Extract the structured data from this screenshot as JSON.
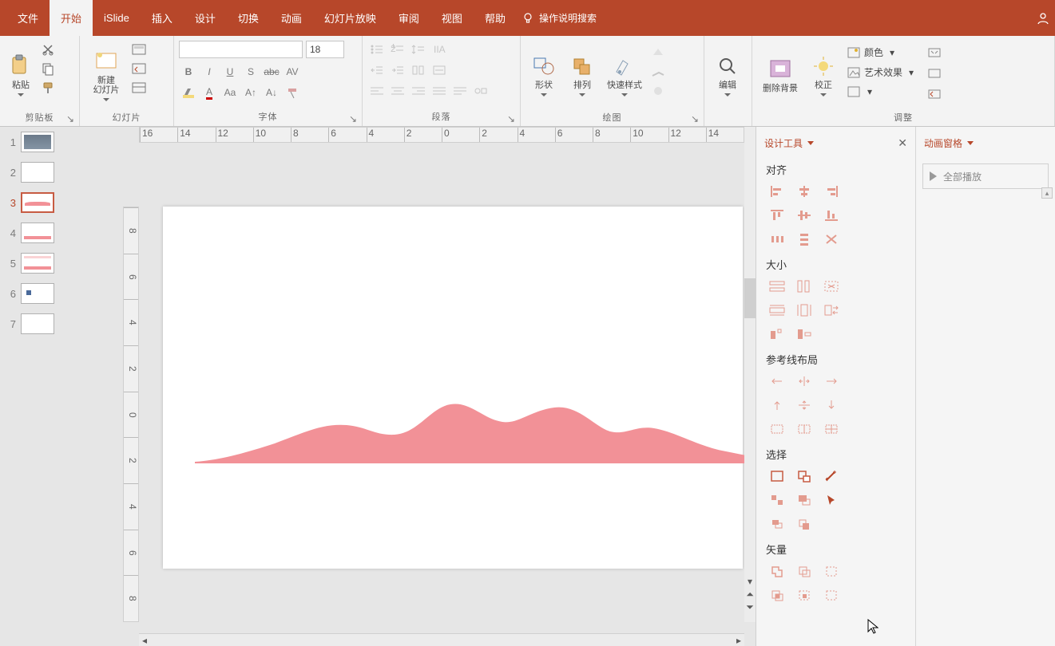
{
  "menu": {
    "tabs": [
      "文件",
      "开始",
      "iSlide",
      "插入",
      "设计",
      "切换",
      "动画",
      "幻灯片放映",
      "审阅",
      "视图",
      "帮助"
    ],
    "tell": "操作说明搜索"
  },
  "ribbon": {
    "clipboard": {
      "paste": "粘贴",
      "label": "剪贴板"
    },
    "slides": {
      "new": "新建\n幻灯片",
      "label": "幻灯片"
    },
    "font": {
      "size": "18",
      "label": "字体"
    },
    "para": {
      "label": "段落"
    },
    "drawing": {
      "shapes": "形状",
      "arrange": "排列",
      "quickstyle": "快速样式",
      "label": "绘图"
    },
    "edit": {
      "edit": "编辑",
      "label": ""
    },
    "adjust": {
      "removebg": "删除背景",
      "correct": "校正",
      "color": "颜色",
      "effects": "艺术效果",
      "label": "调整"
    }
  },
  "thumbs": [
    1,
    2,
    3,
    4,
    5,
    6,
    7
  ],
  "activeSlide": 3,
  "hruler": [
    "16",
    "14",
    "12",
    "10",
    "8",
    "6",
    "4",
    "2",
    "0",
    "2",
    "4",
    "6",
    "8",
    "10",
    "12",
    "14"
  ],
  "vruler": [
    "8",
    "6",
    "4",
    "2",
    "0",
    "2",
    "4",
    "6",
    "8"
  ],
  "designPane": {
    "title": "设计工具",
    "sections": {
      "align": "对齐",
      "size": "大小",
      "guides": "参考线布局",
      "select": "选择",
      "vector": "矢量"
    }
  },
  "animPane": {
    "title": "动画窗格",
    "playAll": "全部播放"
  }
}
